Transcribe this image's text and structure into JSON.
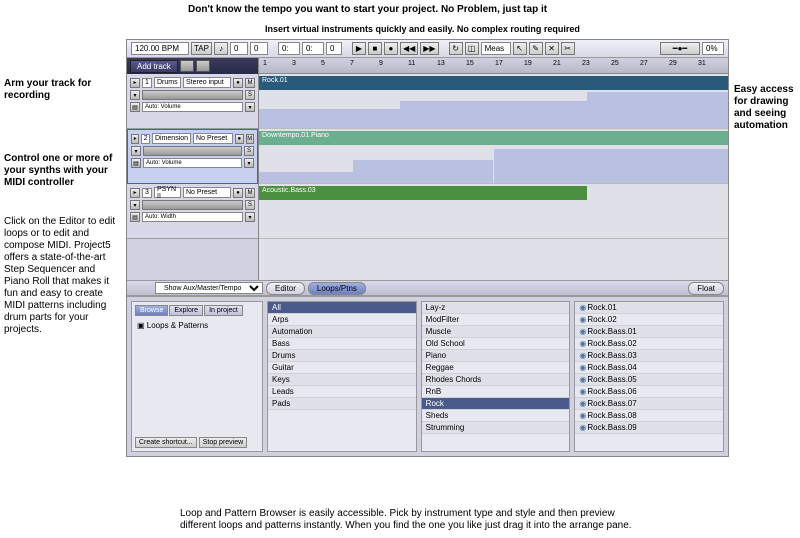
{
  "annotations": {
    "tempo": "Don't know the tempo you want to start your project. No Problem, just tap it",
    "instruments": "Insert virtual instruments quickly and easily. No complex routing required",
    "arm": "Arm your track for recording",
    "midi_controller": "Control one or more of your synths with your MIDI controller",
    "editor": "Click on the Editor to edit loops or to edit and compose MIDI. Project5 offers a state-of-the-art Step Sequencer and Piano Roll that makes it fun and easy to create MIDI patterns including drum parts for your projects.",
    "automation": "Easy access for drawing and seeing automation",
    "browser": "Loop and Pattern Browser is easily accessible. Pick by instrument type and style and then preview different loops and patterns instantly. When you find the one you like just drag it into the arrange pane."
  },
  "toolbar": {
    "bpm": "120.00 BPM",
    "tap": "TAP",
    "time_a": "0",
    "time_b": "0",
    "time_c": "0:",
    "time_d": "0:",
    "time_e": "0",
    "snap": "Meas",
    "slider": "0%"
  },
  "track_bar": {
    "add": "Add track"
  },
  "tracks": [
    {
      "num": "1",
      "name": "Drums",
      "preset": "Stereo input",
      "auto": "Auto: Volume"
    },
    {
      "num": "2",
      "name": "Dimension",
      "preset": "No Preset",
      "auto": "Auto: Volume"
    },
    {
      "num": "3",
      "name": "PSYN II",
      "preset": "No Preset",
      "auto": "Auto: Width"
    }
  ],
  "ruler_marks": [
    "1",
    "3",
    "5",
    "7",
    "9",
    "11",
    "13",
    "15",
    "17",
    "19",
    "21",
    "23",
    "25",
    "27",
    "29",
    "31"
  ],
  "clips": {
    "rock": "Rock.01",
    "downtempo": "Downtempo.01.Piano",
    "bass": "Acoustic.Bass.03"
  },
  "middle": {
    "show": "Show Aux/Master/Tempo",
    "editor": "Editor",
    "loops": "Loops/Ptns",
    "float": "Float"
  },
  "browser": {
    "tabs": {
      "browse": "Browse",
      "explore": "Explore",
      "inproject": "In project"
    },
    "tree_label": "Loops & Patterns",
    "create_shortcut": "Create shortcut...",
    "stop_preview": "Stop preview",
    "col1": [
      "All",
      "Arps",
      "Automation",
      "Bass",
      "Drums",
      "Guitar",
      "Keys",
      "Leads",
      "Pads"
    ],
    "col2": [
      "Lay-z",
      "ModFilter",
      "Muscle",
      "Old School",
      "Piano",
      "Reggae",
      "Rhodes Chords",
      "RnB",
      "Rock",
      "Sheds",
      "Strumming"
    ],
    "col2_selected": "Rock",
    "col3": [
      "Rock.01",
      "Rock.02",
      "Rock.Bass.01",
      "Rock.Bass.02",
      "Rock.Bass.03",
      "Rock.Bass.04",
      "Rock.Bass.05",
      "Rock.Bass.06",
      "Rock.Bass.07",
      "Rock.Bass.08",
      "Rock.Bass.09"
    ]
  }
}
